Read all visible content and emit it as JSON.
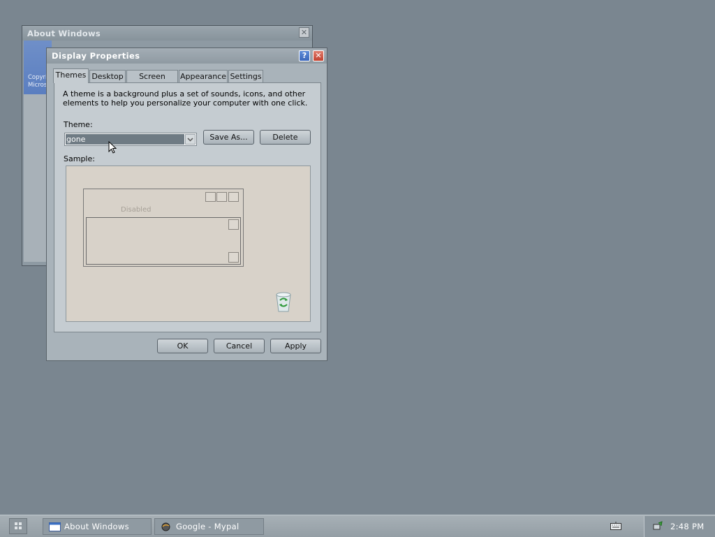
{
  "about_window": {
    "title": "About Windows",
    "close_symbol": "✕",
    "banner_text": [
      "Copyri",
      "Micros"
    ]
  },
  "display_properties": {
    "title": "Display Properties",
    "help_symbol": "?",
    "close_symbol": "✕",
    "tabs": [
      {
        "label": "Themes",
        "active": true
      },
      {
        "label": "Desktop",
        "active": false
      },
      {
        "label": "Screen Saver",
        "active": false
      },
      {
        "label": "Appearance",
        "active": false
      },
      {
        "label": "Settings",
        "active": false
      }
    ],
    "description": "A theme is a background plus a set of sounds, icons, and other elements to help you personalize your computer with one click.",
    "theme_label": "Theme:",
    "theme_value": "gone",
    "save_as_label": "Save As...",
    "delete_label": "Delete",
    "sample_label": "Sample:",
    "sample": {
      "disabled_text": "Disabled"
    },
    "ok_label": "OK",
    "cancel_label": "Cancel",
    "apply_label": "Apply"
  },
  "taskbar": {
    "tasks": [
      {
        "label": "About Windows",
        "icon": "window-icon"
      },
      {
        "label": "Google - Mypal",
        "icon": "mypal-browser-icon"
      }
    ],
    "clock": "2:48 PM"
  },
  "colors": {
    "desktop": "#7a8690",
    "selection": "#6f7b84",
    "sample_bg": "#d8d2c9"
  }
}
